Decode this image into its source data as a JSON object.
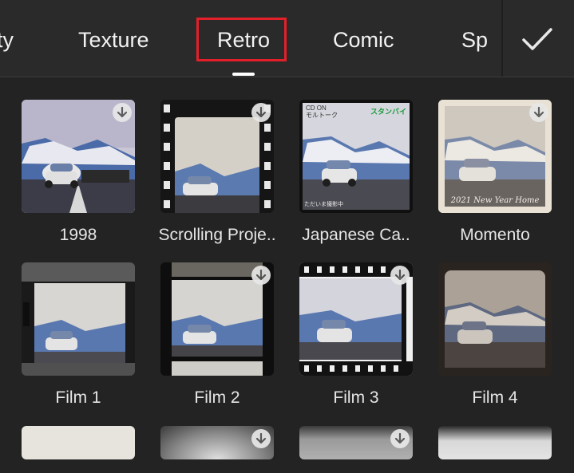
{
  "tabs": [
    {
      "label": "ty"
    },
    {
      "label": "Texture"
    },
    {
      "label": "Retro"
    },
    {
      "label": "Comic"
    },
    {
      "label": "Sp"
    }
  ],
  "items": [
    {
      "label": "1998"
    },
    {
      "label": "Scrolling Proje.."
    },
    {
      "label": "Japanese Ca.."
    },
    {
      "label": "Momento"
    },
    {
      "label": "Film 1"
    },
    {
      "label": "Film 2"
    },
    {
      "label": "Film 3"
    },
    {
      "label": "Film 4"
    },
    {
      "label": ""
    },
    {
      "label": ""
    },
    {
      "label": ""
    },
    {
      "label": ""
    }
  ],
  "thumb_texts": {
    "japanese_top_left": "CD ON\nモルトーク",
    "japanese_top_right": "スタンバイ",
    "japanese_bottom_left": "ただいま撮影中",
    "momento_caption": "2021 New Year Home"
  },
  "icons": {
    "confirm": "checkmark-icon",
    "download": "download-arrow-icon"
  },
  "colors": {
    "highlight_box": "#e3202a",
    "background": "#232323",
    "topbar": "#2a2a2a"
  }
}
